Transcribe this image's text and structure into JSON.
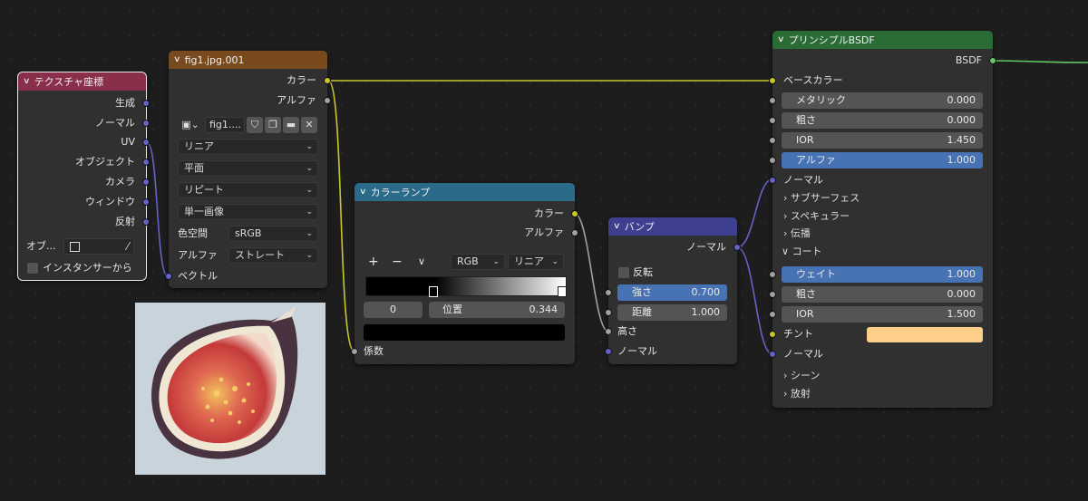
{
  "colors": {
    "texcoord_header": "#8a2f4a",
    "image_header": "#7a4a1f",
    "colorramp_header": "#2a6b8a",
    "bump_header": "#3f3f8f",
    "bsdf_header": "#2b6b36",
    "wire_yellow": "#c7c729",
    "wire_purple": "#6363c7",
    "wire_grey": "#a1a1a1",
    "wire_green": "#63c763",
    "tint_swatch": "#ffcf8a"
  },
  "texcoord": {
    "title": "テクスチャ座標",
    "outputs": [
      "生成",
      "ノーマル",
      "UV",
      "オブジェクト",
      "カメラ",
      "ウィンドウ",
      "反射"
    ],
    "object_label": "オブ...",
    "instancer_label": "インスタンサーから"
  },
  "image": {
    "title": "fig1.jpg.001",
    "out_color": "カラー",
    "out_alpha": "アルファ",
    "image_name": "fig1....",
    "interpolation": "リニア",
    "projection": "平面",
    "extension": "リピート",
    "source": "単一画像",
    "colorspace_label": "色空間",
    "colorspace_value": "sRGB",
    "alpha_label": "アルファ",
    "alpha_value": "ストレート",
    "in_vector": "ベクトル"
  },
  "colorramp": {
    "title": "カラーランプ",
    "out_color": "カラー",
    "out_alpha": "アルファ",
    "add": "+",
    "remove": "−",
    "mode": "RGB",
    "interp": "リニア",
    "index": "0",
    "pos_label": "位置",
    "pos_value": "0.344",
    "in_fac": "係数"
  },
  "bump": {
    "title": "バンプ",
    "out_normal": "ノーマル",
    "invert": "反転",
    "strength_label": "強さ",
    "strength_value": "0.700",
    "distance_label": "距離",
    "distance_value": "1.000",
    "in_height": "高さ",
    "in_normal": "ノーマル"
  },
  "bsdf": {
    "title": "プリンシプルBSDF",
    "out_bsdf": "BSDF",
    "base_color": "ベースカラー",
    "metallic_label": "メタリック",
    "metallic_value": "0.000",
    "rough_label": "粗さ",
    "rough_value": "0.000",
    "ior_label": "IOR",
    "ior_value": "1.450",
    "alpha_label": "アルファ",
    "alpha_value": "1.000",
    "normal": "ノーマル",
    "subsurface": "サブサーフェス",
    "specular": "スペキュラー",
    "transmission": "伝播",
    "coat": "コート",
    "coat_weight_label": "ウェイト",
    "coat_weight_value": "1.000",
    "coat_rough_label": "粗さ",
    "coat_rough_value": "0.000",
    "coat_ior_label": "IOR",
    "coat_ior_value": "1.500",
    "tint": "チント",
    "coat_normal": "ノーマル",
    "sheen": "シーン",
    "emission": "放射"
  },
  "icons": [
    "chevron-down-icon",
    "chevron-right-icon",
    "image-icon",
    "shield-icon",
    "duplicate-icon",
    "folder-icon",
    "close-icon",
    "eyedropper-icon"
  ]
}
